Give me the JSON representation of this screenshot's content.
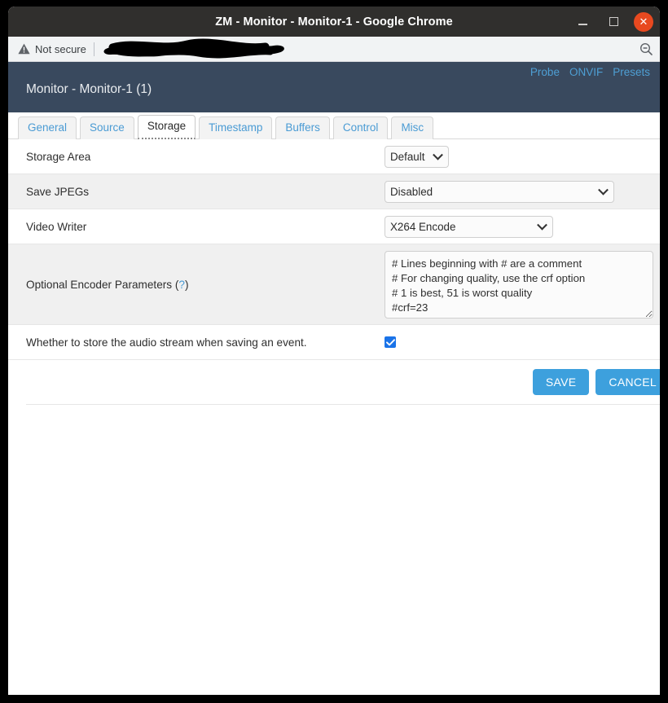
{
  "window": {
    "title": "ZM - Monitor - Monitor-1 - Google Chrome",
    "minimize_label": "–",
    "maximize_label": "",
    "close_label": "✕",
    "close_color": "#e8491f",
    "titlebar_color": "#302f2d"
  },
  "omnibox": {
    "security_label": "Not secure",
    "security_icon": "warning-triangle-icon",
    "url_value": "",
    "url_redacted": true,
    "zoom_icon": "zoom-out-magnifier-icon"
  },
  "zm_header": {
    "title": "Monitor - Monitor-1 (1)",
    "background": "#39495e",
    "link_color": "#4e9fd4",
    "nav": [
      {
        "label": "Probe",
        "name": "probe-link"
      },
      {
        "label": "ONVIF",
        "name": "onvif-link"
      },
      {
        "label": "Presets",
        "name": "presets-link"
      }
    ]
  },
  "tabs": [
    {
      "label": "General",
      "active": false
    },
    {
      "label": "Source",
      "active": false
    },
    {
      "label": "Storage",
      "active": true
    },
    {
      "label": "Timestamp",
      "active": false
    },
    {
      "label": "Buffers",
      "active": false
    },
    {
      "label": "Control",
      "active": false
    },
    {
      "label": "Misc",
      "active": false
    }
  ],
  "form": {
    "storage_area": {
      "label": "Storage Area",
      "value": "Default"
    },
    "save_jpegs": {
      "label": "Save JPEGs",
      "value": "Disabled"
    },
    "video_writer": {
      "label": "Video Writer",
      "value": "X264 Encode"
    },
    "encoder_params": {
      "label": "Optional Encoder Parameters",
      "help_label": "(?)",
      "help_open": "(",
      "help_mark": "?",
      "help_close": ")",
      "value": "# Lines beginning with # are a comment\n# For changing quality, use the crf option\n# 1 is best, 51 is worst quality\n#crf=23"
    },
    "audio_stream": {
      "label": "Whether to store the audio stream when saving an event.",
      "checked": true,
      "checkbox_color": "#1a73e8"
    }
  },
  "buttons": {
    "save_label": "SAVE",
    "cancel_label": "CANCEL",
    "color": "#3da0dd"
  }
}
